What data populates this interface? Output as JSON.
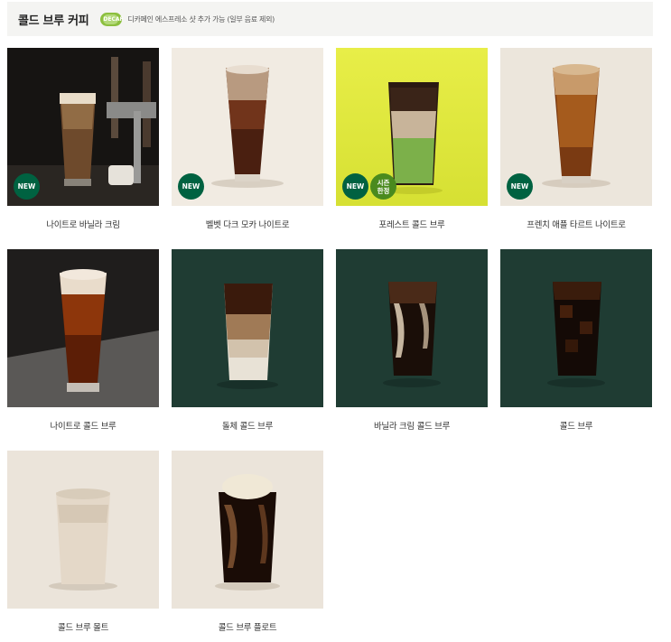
{
  "header": {
    "title": "콜드 브루 커피",
    "decaf_badge": "DECAF",
    "decaf_note": "디카페인 에스프레소 샷 추가 가능 (일부 음료 제외)"
  },
  "products": [
    {
      "name": "나이트로 바닐라 크림",
      "badges": [
        "NEW"
      ]
    },
    {
      "name": "벨벳 다크 모카 나이트로",
      "badges": [
        "NEW"
      ]
    },
    {
      "name": "포레스트 콜드 브루",
      "badges": [
        "NEW",
        "시즌\n한정"
      ]
    },
    {
      "name": "프렌치 애플 타르트 나이트로",
      "badges": [
        "NEW"
      ]
    },
    {
      "name": "나이트로 콜드 브루",
      "badges": []
    },
    {
      "name": "돌체 콜드 브루",
      "badges": []
    },
    {
      "name": "바닐라 크림 콜드 브루",
      "badges": []
    },
    {
      "name": "콜드 브루",
      "badges": []
    },
    {
      "name": "콜드 브루 몰트",
      "badges": []
    },
    {
      "name": "콜드 브루 플로트",
      "badges": []
    }
  ],
  "colors": {
    "new_badge": "#006241",
    "season_badge": "#4a8a1e",
    "dark_green_bg": "#1e3b33",
    "header_bg": "#f4f4f2"
  }
}
